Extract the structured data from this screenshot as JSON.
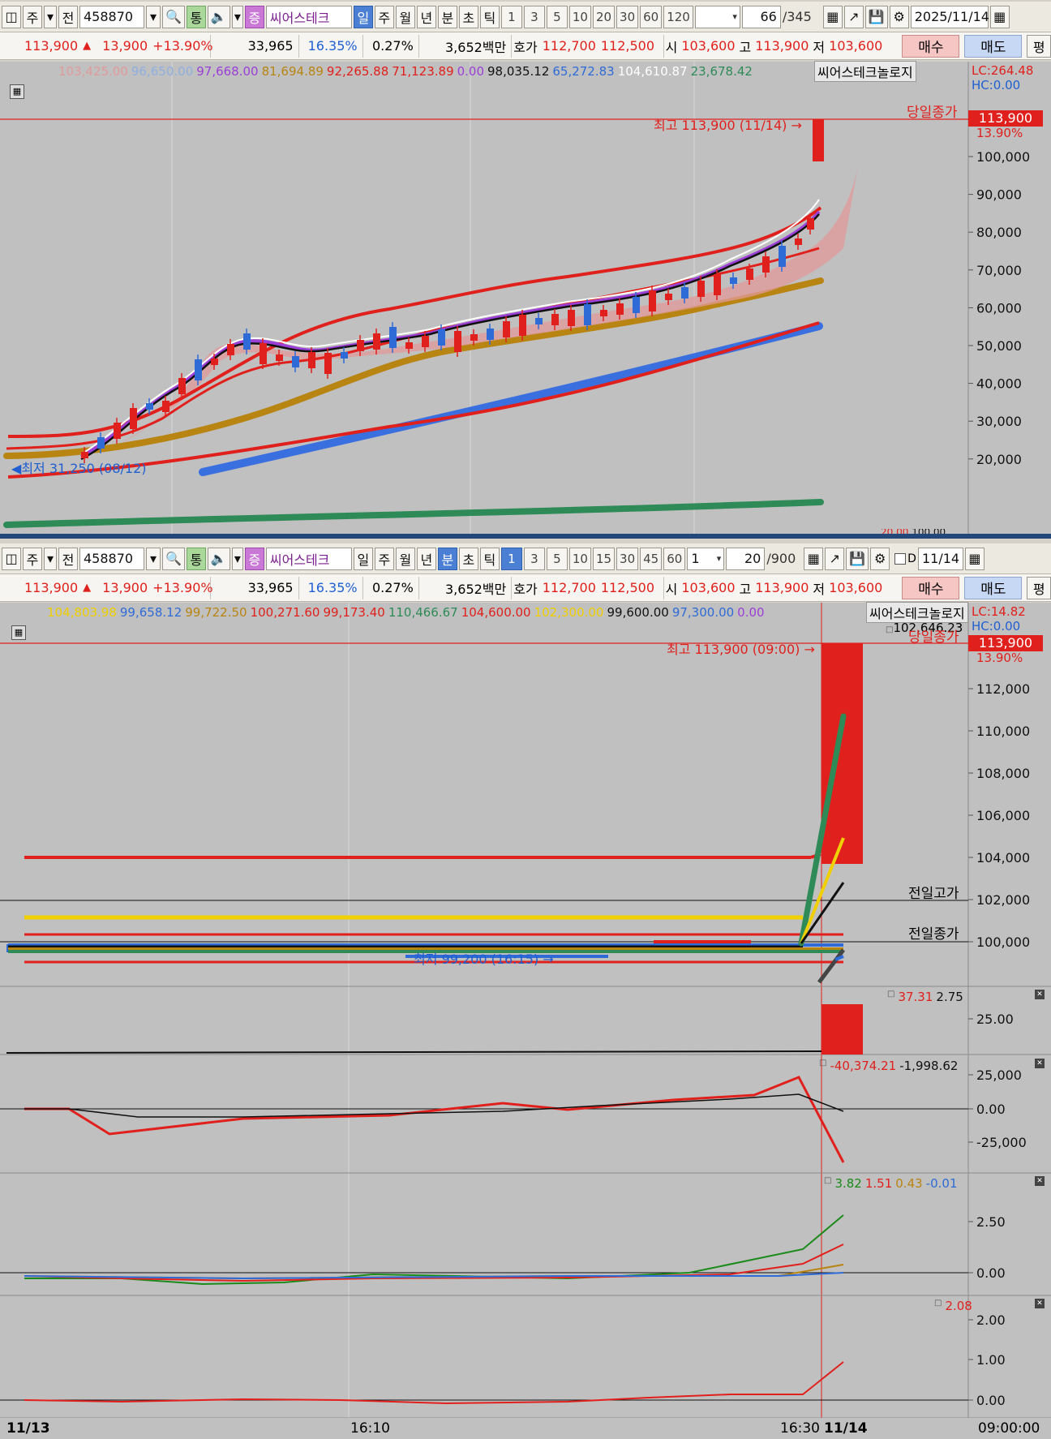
{
  "toolbar_top": {
    "mode_jusik": "주",
    "btn_prev": "전",
    "code": "458870",
    "btn_tong": "통",
    "btn_jeung": "증",
    "stock_name": "씨어스테크",
    "periods": [
      "일",
      "주",
      "월",
      "년",
      "분",
      "초",
      "틱"
    ],
    "active_period": "일",
    "intervals": [
      "1",
      "3",
      "5",
      "10",
      "20",
      "30",
      "60",
      "120"
    ],
    "count": "66",
    "total": "/345",
    "date": "2025/11/14"
  },
  "toolbar_bottom": {
    "mode_jusik": "주",
    "btn_prev": "전",
    "code": "458870",
    "btn_tong": "통",
    "btn_jeung": "증",
    "stock_name": "씨어스테크",
    "periods": [
      "일",
      "주",
      "월",
      "년",
      "분",
      "초",
      "틱"
    ],
    "active_period": "분",
    "intervals": [
      "1",
      "3",
      "5",
      "10",
      "15",
      "30",
      "45",
      "60"
    ],
    "active_interval": "1",
    "interval_select": "1",
    "count": "20",
    "total": "/900",
    "d_label": "D",
    "date": "11/14"
  },
  "quote": {
    "price": "113,900",
    "arrow": "▲",
    "change": "13,900",
    "change_pct": "+13.90%",
    "volume": "33,965",
    "turnover_pct": "16.35%",
    "ratio_pct": "0.27%",
    "amount": "3,652백만",
    "hoga_label": "호가",
    "ask": "112,700",
    "bid": "112,500",
    "open_label": "시",
    "open": "103,600",
    "high_label": "고",
    "high": "113,900",
    "low_label": "저",
    "low": "103,600",
    "buy": "매수",
    "sell": "매도",
    "avg": "평"
  },
  "top_chart": {
    "legend": [
      {
        "text": "103,425.00",
        "color": "#e09a9a"
      },
      {
        "text": "96,650.00",
        "color": "#8faee0"
      },
      {
        "text": "97,668.00",
        "color": "#9b3fd6"
      },
      {
        "text": "81,694.89",
        "color": "#b88412"
      },
      {
        "text": "92,265.88",
        "color": "#e0201c"
      },
      {
        "text": "71,123.89",
        "color": "#e0201c"
      },
      {
        "text": "0.00",
        "color": "#9b3fd6"
      },
      {
        "text": "98,035.12",
        "color": "#111111"
      },
      {
        "text": "65,272.83",
        "color": "#2f6bd6"
      },
      {
        "text": "104,610.87",
        "color": "#ffffff"
      },
      {
        "text": "23,678.42",
        "color": "#2e8b57"
      }
    ],
    "indicator_name": "씨어스테크놀로지",
    "lc": "LC:264.48",
    "hc": "HC:0.00",
    "close_label": "당일종가",
    "price_tag": "113,900",
    "pct_tag": "13.90%",
    "high_note": "최고 113,900 (11/14)",
    "low_note": "최저 31,250 (08/12)",
    "y_ticks": [
      "100,000",
      "90,000",
      "80,000",
      "70,000",
      "60,000",
      "50,000",
      "40,000",
      "30,000",
      "20,000"
    ],
    "y_values": [
      100000,
      90000,
      80000,
      70000,
      60000,
      50000,
      40000,
      30000,
      20000
    ],
    "y_cut": "20,00",
    "y_cut2": "100,00"
  },
  "bottom_chart": {
    "legend": [
      {
        "text": "104,803.98",
        "color": "#f0d000"
      },
      {
        "text": "99,658.12",
        "color": "#2f6bd6"
      },
      {
        "text": "99,722.50",
        "color": "#b88412"
      },
      {
        "text": "100,271.60",
        "color": "#e0201c"
      },
      {
        "text": "99,173.40",
        "color": "#e0201c"
      },
      {
        "text": "110,466.67",
        "color": "#2e8b57"
      },
      {
        "text": "104,600.00",
        "color": "#e0201c"
      },
      {
        "text": "102,300.00",
        "color": "#f0d000"
      },
      {
        "text": "99,600.00",
        "color": "#111111"
      },
      {
        "text": "97,300.00",
        "color": "#2f6bd6"
      },
      {
        "text": "0.00",
        "color": "#9b3fd6"
      }
    ],
    "indicator_name": "씨어스테크놀로지",
    "extra_value": "102,646.23",
    "lc": "LC:14.82",
    "hc": "HC:0.00",
    "close_label": "당일종가",
    "price_tag": "113,900",
    "pct_tag": "13.90%",
    "high_note": "최고 113,900 (09:00)",
    "low_note": "최저 99,200 (16:15)",
    "prev_high_label": "전일고가",
    "prev_close_label": "전일종가",
    "y_ticks": [
      "112,000",
      "110,000",
      "108,000",
      "106,000",
      "104,000",
      "102,000",
      "100,000"
    ],
    "y_values": [
      112000,
      110000,
      108000,
      106000,
      104000,
      102000,
      100000
    ]
  },
  "sub1": {
    "values": [
      "37.31",
      "2.75"
    ],
    "colors": [
      "#e0201c",
      "#111111"
    ],
    "y_ticks": [
      "25.00"
    ]
  },
  "sub2": {
    "values": [
      "-40,374.21",
      "-1,998.62"
    ],
    "colors": [
      "#e0201c",
      "#111111"
    ],
    "y_ticks": [
      "25,000",
      "0.00",
      "-25,000"
    ]
  },
  "sub3": {
    "values": [
      "3.82",
      "1.51",
      "0.43",
      "-0.01"
    ],
    "colors": [
      "#1a8a1a",
      "#e0201c",
      "#b88412",
      "#2f6bd6"
    ],
    "y_ticks": [
      "2.50",
      "0.00"
    ]
  },
  "sub4": {
    "values": [
      "2.08"
    ],
    "colors": [
      "#e0201c"
    ],
    "y_ticks": [
      "2.00",
      "1.00",
      "0.00"
    ]
  },
  "x_axis": {
    "labels": [
      "11/13",
      "16:10",
      "16:30",
      "11/14"
    ],
    "time": "09:00:00"
  }
}
